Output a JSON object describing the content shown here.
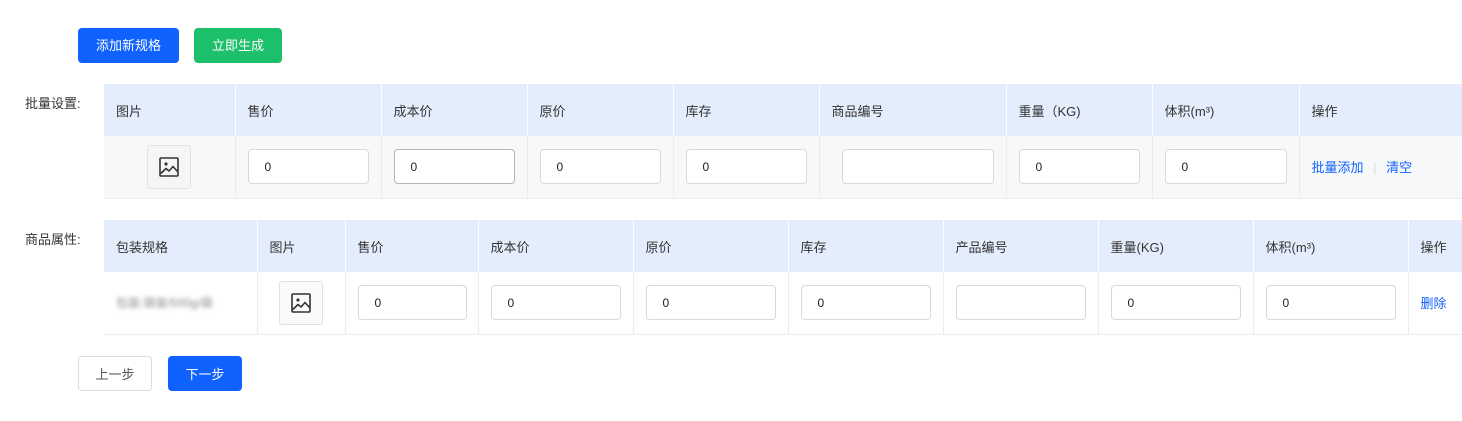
{
  "toolbar": {
    "add_spec_label": "添加新规格",
    "generate_label": "立即生成"
  },
  "batch": {
    "label": "批量设置:",
    "headers": [
      "图片",
      "售价",
      "成本价",
      "原价",
      "库存",
      "商品编号",
      "重量（KG)",
      "体积(m³)",
      "操作"
    ],
    "values": {
      "price": "0",
      "cost": "0",
      "original": "0",
      "stock": "0",
      "sku": "",
      "weight": "0",
      "volume": "0"
    },
    "actions": {
      "batch_add": "批量添加",
      "clear": "清空"
    }
  },
  "attrs": {
    "label": "商品属性:",
    "headers": [
      "包装规格",
      "图片",
      "售价",
      "成本价",
      "原价",
      "库存",
      "产品编号",
      "重量(KG)",
      "体积(m³)",
      "操作"
    ],
    "rows": [
      {
        "spec": "包装:袋装/500g/袋",
        "price": "0",
        "cost": "0",
        "original": "0",
        "stock": "0",
        "sku": "",
        "weight": "0",
        "volume": "0",
        "delete": "删除"
      }
    ]
  },
  "footer": {
    "prev_label": "上一步",
    "next_label": "下一步"
  },
  "colors": {
    "primary": "#1062fe",
    "success": "#1cc06a",
    "header_bg": "#e4edfc"
  }
}
